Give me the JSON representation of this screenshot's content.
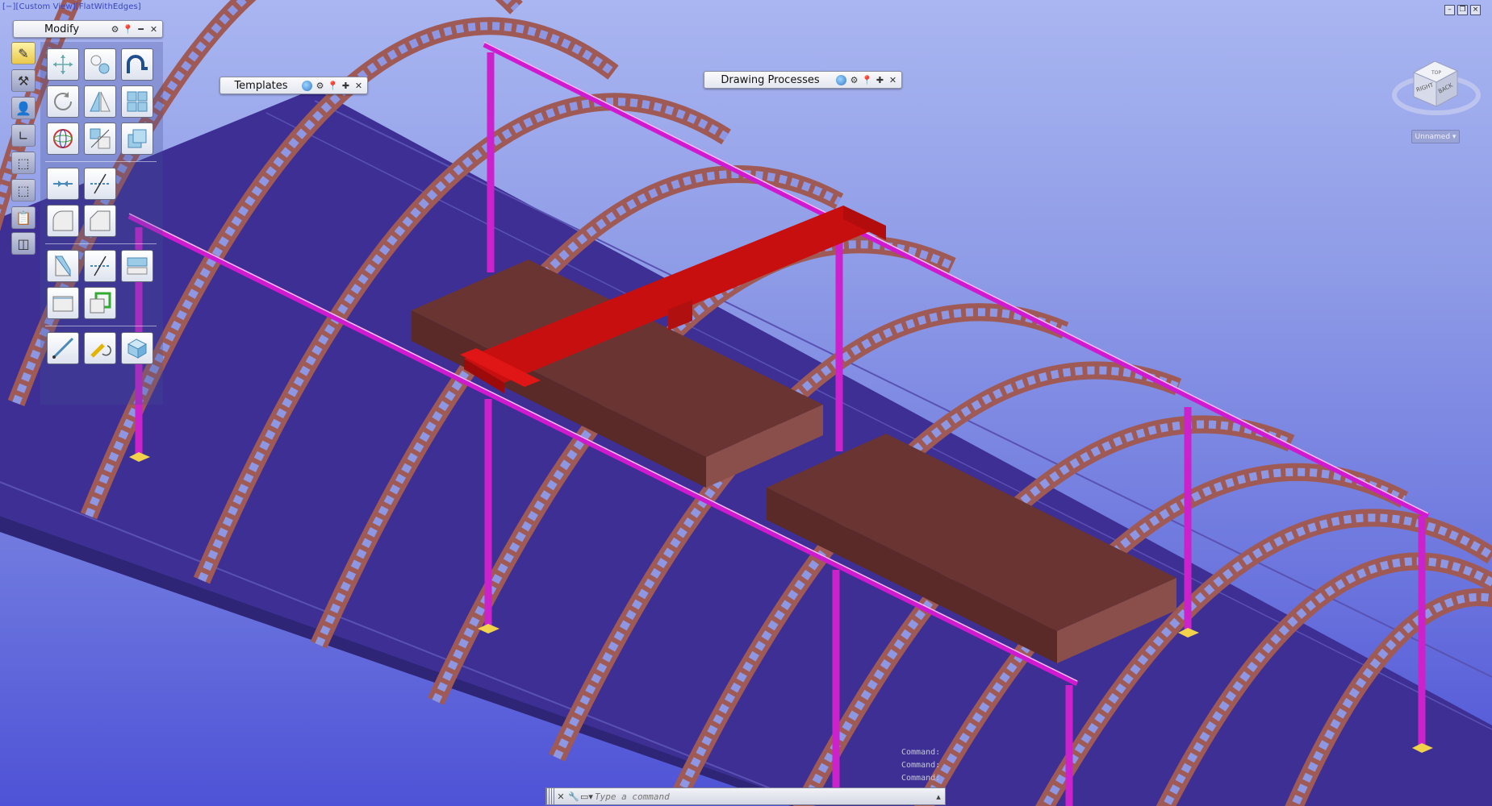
{
  "viewport": {
    "label": "[−][Custom View][FlatWithEdges]",
    "background": "#7a84e0"
  },
  "palettes": {
    "modify": {
      "title": "Modify"
    },
    "templates": {
      "title": "Templates"
    },
    "drawing_processes": {
      "title": "Drawing Processes"
    }
  },
  "navcube": {
    "faces": {
      "top": "TOP",
      "right": "RIGHT",
      "back": "BACK"
    },
    "view_name": "Unnamed"
  },
  "left_strip_icons": [
    "pencil-icon",
    "tools-icon",
    "user-icon",
    "angle-icon",
    "select-box-icon",
    "select-cross-icon",
    "clipboard-icon",
    "layers-icon"
  ],
  "modify_tools": {
    "group1": [
      "move-icon",
      "align-icon",
      "tube-bend-icon",
      "rotate-icon",
      "mirror-icon",
      "array-icon",
      "sphere-icon",
      "scale-icon",
      "copy-3d-icon"
    ],
    "group2": [
      "extend-icon",
      "split-icon",
      "fillet-icon",
      "chamfer-icon"
    ],
    "group3": [
      "plane-cut-icon",
      "line-cut-icon",
      "section-icon",
      "plate-icon",
      "offset-icon"
    ],
    "group4": [
      "beam-tool-icon",
      "weld-icon",
      "solid-box-icon"
    ]
  },
  "command": {
    "history": [
      "Command:",
      "Command:",
      "Command:"
    ],
    "placeholder": "Type a command"
  },
  "colors": {
    "arch": "#a05a55",
    "column": "#cc22cc",
    "crane": "#d81010",
    "box_top": "#6a3433",
    "floor": "#3d2f94"
  }
}
